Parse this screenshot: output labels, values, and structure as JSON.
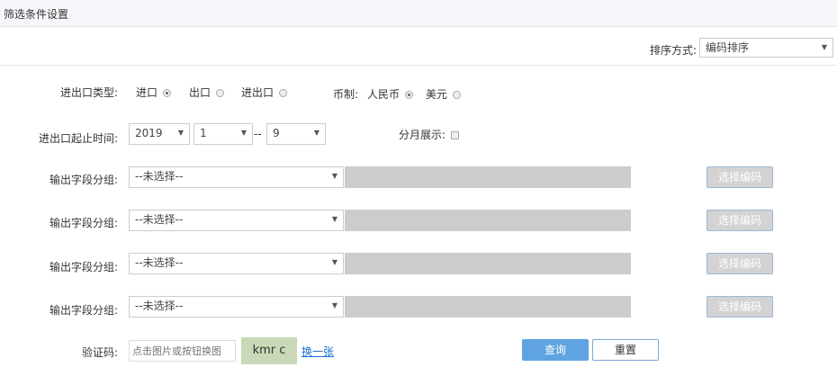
{
  "header": {
    "title": "筛选条件设置"
  },
  "sort": {
    "label": "排序方式:",
    "value": "编码排序"
  },
  "trade_type": {
    "label": "进出口类型:",
    "options": [
      {
        "label": "进口",
        "checked": true
      },
      {
        "label": "出口",
        "checked": false
      },
      {
        "label": "进出口",
        "checked": false
      }
    ]
  },
  "currency": {
    "label": "币制:",
    "options": [
      {
        "label": "人民币",
        "checked": true
      },
      {
        "label": "美元",
        "checked": false
      }
    ]
  },
  "period": {
    "label": "进出口起止时间:",
    "year": "2019",
    "start_month": "1",
    "separator": "--",
    "end_month": "9"
  },
  "monthly": {
    "label": "分月展示:",
    "checked": false
  },
  "groups": [
    {
      "label": "输出字段分组:",
      "value": "--未选择--",
      "button": "选择编码"
    },
    {
      "label": "输出字段分组:",
      "value": "--未选择--",
      "button": "选择编码"
    },
    {
      "label": "输出字段分组:",
      "value": "--未选择--",
      "button": "选择编码"
    },
    {
      "label": "输出字段分组:",
      "value": "--未选择--",
      "button": "选择编码"
    }
  ],
  "captcha": {
    "label": "验证码:",
    "placeholder": "点击图片或按钮换图",
    "image_text": "kmr c",
    "refresh": "换一张"
  },
  "actions": {
    "query": "查询",
    "reset": "重置",
    "query_color": "#5fa3e0"
  }
}
